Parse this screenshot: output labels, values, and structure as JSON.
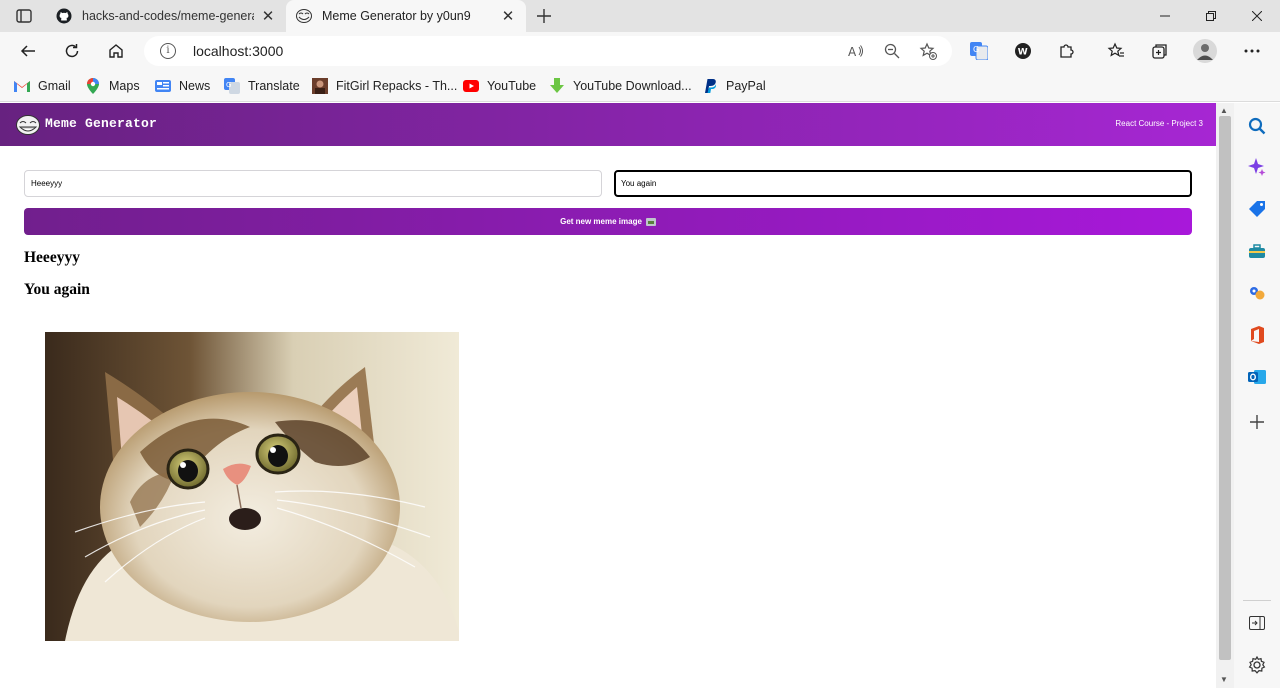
{
  "browser": {
    "tabs": [
      {
        "title": "hacks-and-codes/meme-generat",
        "favicon": "github-icon",
        "active": false
      },
      {
        "title": "Meme Generator by y0un9",
        "favicon": "troll-face-icon",
        "active": true
      }
    ],
    "address": {
      "url": "localhost:3000"
    },
    "bookmarks": [
      {
        "label": "Gmail",
        "icon": "gmail-icon"
      },
      {
        "label": "Maps",
        "icon": "maps-icon"
      },
      {
        "label": "News",
        "icon": "news-icon"
      },
      {
        "label": "Translate",
        "icon": "translate-icon"
      },
      {
        "label": "FitGirl Repacks - Th...",
        "icon": "fitgirl-icon"
      },
      {
        "label": "YouTube",
        "icon": "youtube-icon"
      },
      {
        "label": "YouTube Download...",
        "icon": "download-icon"
      },
      {
        "label": "PayPal",
        "icon": "paypal-icon"
      }
    ]
  },
  "app": {
    "title": "Meme Generator",
    "subtitle": "React Course - Project 3",
    "accent_start": "#672280",
    "accent_end": "#a626d3",
    "form": {
      "top_text_value": "Heeeyyy",
      "bottom_text_value": "You again",
      "button_label": "Get new meme image"
    },
    "meme": {
      "top_text": "Heeeyyy",
      "bottom_text": "You again",
      "image": "shocked-cat-photo"
    }
  }
}
